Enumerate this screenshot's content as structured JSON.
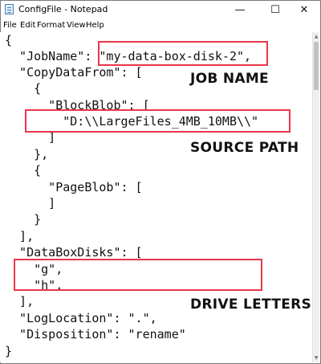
{
  "window": {
    "title": "ConfigFile - Notepad",
    "buttons": {
      "minimize": "—",
      "maximize": "☐",
      "close": "✕"
    }
  },
  "menu": [
    "File",
    "Edit",
    "Format",
    "View",
    "Help"
  ],
  "code_lines": [
    "{",
    "  \"JobName\": \"my-data-box-disk-2\",",
    "  \"CopyDataFrom\": [",
    "    {",
    "      \"BlockBlob\": [",
    "        \"D:\\\\LargeFiles_4MB_10MB\\\\\"",
    "      ]",
    "    },",
    "    {",
    "      \"PageBlob\": [",
    "      ]",
    "    }",
    "  ],",
    "  \"DataBoxDisks\": [",
    "    \"g\",",
    "    \"h\",",
    "  ],",
    "  \"LogLocation\": \".\",",
    "  \"Disposition\": \"rename\"",
    "}"
  ],
  "annotations": {
    "job_name": "JOB NAME",
    "source_path": "SOURCE PATH",
    "drive_letters": "DRIVE LETTERS"
  },
  "colors": {
    "highlight": "#e8384a"
  }
}
